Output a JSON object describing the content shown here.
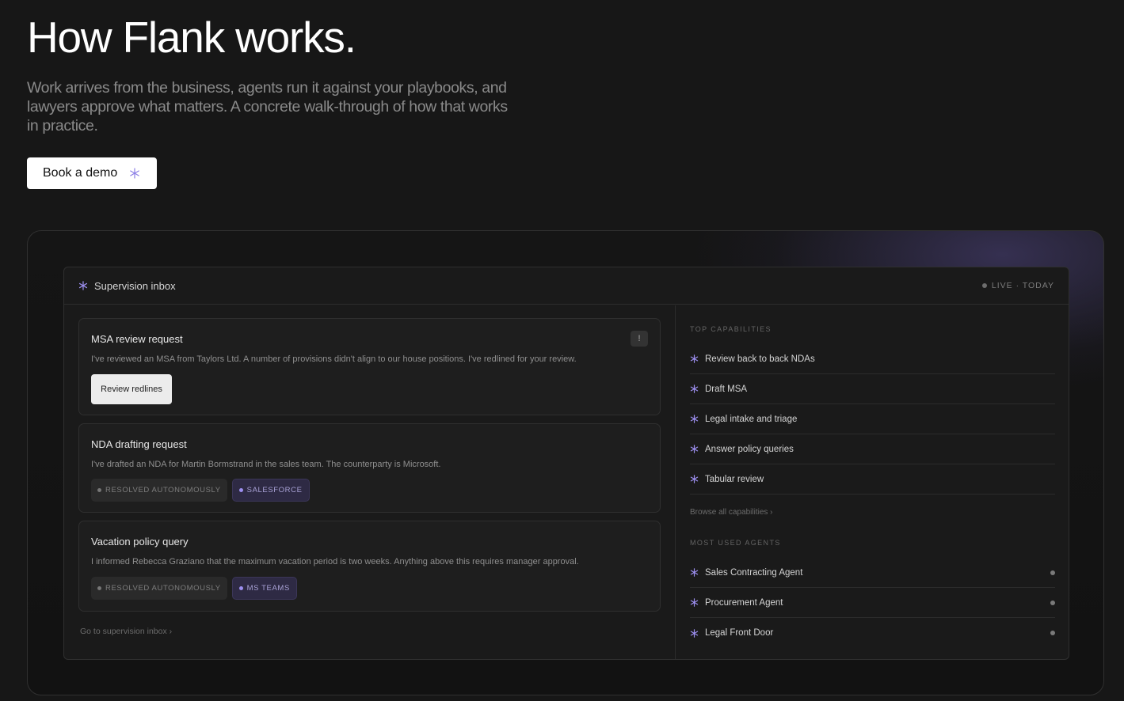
{
  "hero": {
    "title": "How Flank works.",
    "subtitle": "Work arrives from the business, agents run it against your playbooks, and lawyers approve what matters. A concrete walk-through of how that works in practice.",
    "cta_label": "Book a demo"
  },
  "inbox": {
    "title": "Supervision inbox",
    "live_label": "LIVE · TODAY",
    "cards": [
      {
        "title": "MSA review request",
        "body": "I've reviewed an MSA from Taylors Ltd. A number of provisions didn't align to our house positions. I've redlined for your review.",
        "badge": "!",
        "action_label": "Review redlines"
      },
      {
        "title": "NDA drafting request",
        "body": "I've drafted an NDA for Martin Bormstrand in the sales team. The counterparty is Microsoft.",
        "tags": [
          "RESOLVED AUTONOMOUSLY",
          "SALESFORCE"
        ]
      },
      {
        "title": "Vacation policy query",
        "body": "I informed Rebecca Graziano that the maximum vacation period is two weeks. Anything above this requires manager approval.",
        "tags": [
          "RESOLVED AUTONOMOUSLY",
          "MS TEAMS"
        ]
      }
    ],
    "go_link": "Go to supervision inbox ›"
  },
  "capabilities": {
    "label": "TOP CAPABILITIES",
    "items": [
      "Review back to back NDAs",
      "Draft MSA",
      "Legal intake and triage",
      "Answer policy queries",
      "Tabular review"
    ],
    "browse_link": "Browse all capabilities ›"
  },
  "agents": {
    "label": "MOST USED AGENTS",
    "items": [
      "Sales Contracting Agent",
      "Procurement Agent",
      "Legal Front Door"
    ]
  },
  "colors": {
    "accent": "#9d8ff0",
    "background": "#171717"
  },
  "icons": {
    "spark": "asterisk-spark-icon"
  }
}
